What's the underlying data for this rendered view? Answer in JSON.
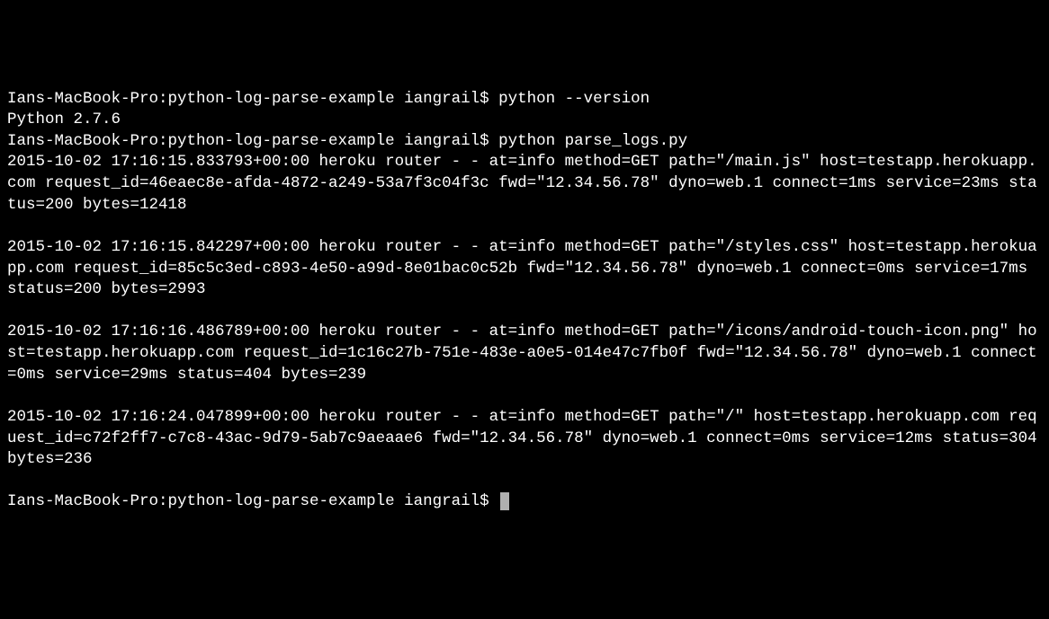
{
  "terminal": {
    "prompt": "Ians-MacBook-Pro:python-log-parse-example iangrail$ ",
    "lines": [
      {
        "type": "cmd",
        "text": "python --version"
      },
      {
        "type": "out",
        "text": "Python 2.7.6"
      },
      {
        "type": "cmd",
        "text": "python parse_logs.py"
      },
      {
        "type": "out",
        "text": "2015-10-02 17:16:15.833793+00:00 heroku router - - at=info method=GET path=\"/main.js\" host=testapp.herokuapp.com request_id=46eaec8e-afda-4872-a249-53a7f3c04f3c fwd=\"12.34.56.78\" dyno=web.1 connect=1ms service=23ms status=200 bytes=12418"
      },
      {
        "type": "blank"
      },
      {
        "type": "out",
        "text": "2015-10-02 17:16:15.842297+00:00 heroku router - - at=info method=GET path=\"/styles.css\" host=testapp.herokuapp.com request_id=85c5c3ed-c893-4e50-a99d-8e01bac0c52b fwd=\"12.34.56.78\" dyno=web.1 connect=0ms service=17ms status=200 bytes=2993"
      },
      {
        "type": "blank"
      },
      {
        "type": "out",
        "text": "2015-10-02 17:16:16.486789+00:00 heroku router - - at=info method=GET path=\"/icons/android-touch-icon.png\" host=testapp.herokuapp.com request_id=1c16c27b-751e-483e-a0e5-014e47c7fb0f fwd=\"12.34.56.78\" dyno=web.1 connect=0ms service=29ms status=404 bytes=239"
      },
      {
        "type": "blank"
      },
      {
        "type": "out",
        "text": "2015-10-02 17:16:24.047899+00:00 heroku router - - at=info method=GET path=\"/\" host=testapp.herokuapp.com request_id=c72f2ff7-c7c8-43ac-9d79-5ab7c9aeaae6 fwd=\"12.34.56.78\" dyno=web.1 connect=0ms service=12ms status=304 bytes=236"
      },
      {
        "type": "blank"
      },
      {
        "type": "prompt-cursor"
      }
    ]
  }
}
